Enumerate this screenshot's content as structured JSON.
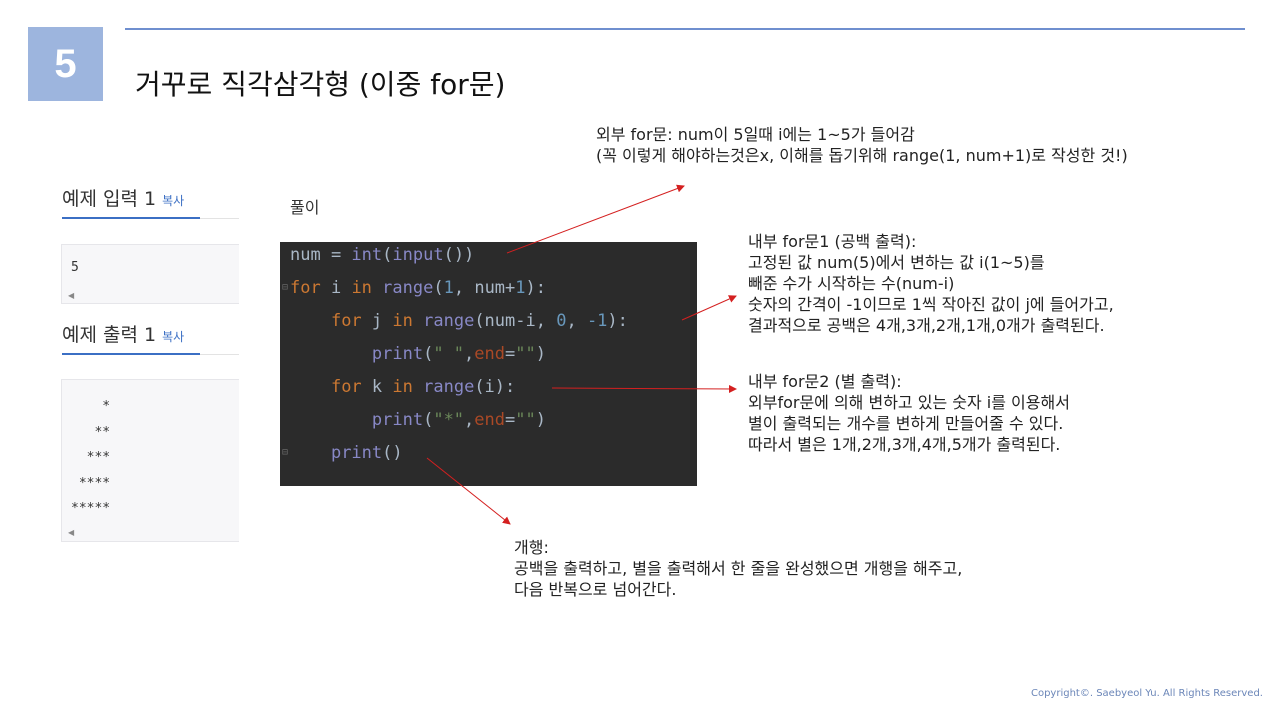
{
  "slide": {
    "number": "5",
    "title": "거꾸로 직각삼각형 (이중 for문)"
  },
  "input_panel": {
    "title": "예제 입력 1",
    "copy_label": "복사",
    "sample": "5"
  },
  "output_panel": {
    "title": "예제 출력 1",
    "copy_label": "복사",
    "sample_lines": [
      "    *",
      "   **",
      "  ***",
      " ****",
      "*****"
    ]
  },
  "solution_label": "풀이",
  "code_lines": [
    "num = int(input())",
    "for i in range(1, num+1):",
    "    for j in range(num-i, 0, -1):",
    "        print(\" \",end=\"\")",
    "    for k in range(i):",
    "        print(\"*\",end=\"\")",
    "    print()"
  ],
  "notes": {
    "outer": {
      "line1": "외부 for문: num이 5일때 i에는 1~5가 들어감",
      "line2": "(꼭 이렇게 해야하는것은x, 이해를 돕기위해 range(1, num+1)로 작성한 것!)"
    },
    "inner1": {
      "line1": "내부 for문1 (공백 출력):",
      "line2": "고정된 값 num(5)에서 변하는 값 i(1~5)를",
      "line3": "빼준 수가 시작하는 수(num-i)",
      "line4": "숫자의 간격이 -1이므로 1씩 작아진 값이 j에 들어가고,",
      "line5": "결과적으로 공백은 4개,3개,2개,1개,0개가 출력된다."
    },
    "inner2": {
      "line1": "내부 for문2 (별 출력):",
      "line2": "외부for문에 의해 변하고 있는 숫자 i를 이용해서",
      "line3": "별이 출력되는 개수를 변하게 만들어줄 수 있다.",
      "line4": "따라서 별은 1개,2개,3개,4개,5개가 출력된다."
    },
    "newline": {
      "line1": "개행:",
      "line2": "공백을 출력하고, 별을 출력해서 한 줄을 완성했으면 개행을 해주고,",
      "line3": "다음 반복으로 넘어간다."
    }
  },
  "footer": "Copyright©. Saebyeol Yu. All Rights Reserved.",
  "colors": {
    "accent_box": "#9db5de",
    "top_rule": "#6f8fcf",
    "code_bg": "#2b2b2b",
    "arrow": "#d42020",
    "link_blue": "#3b6fc4"
  }
}
